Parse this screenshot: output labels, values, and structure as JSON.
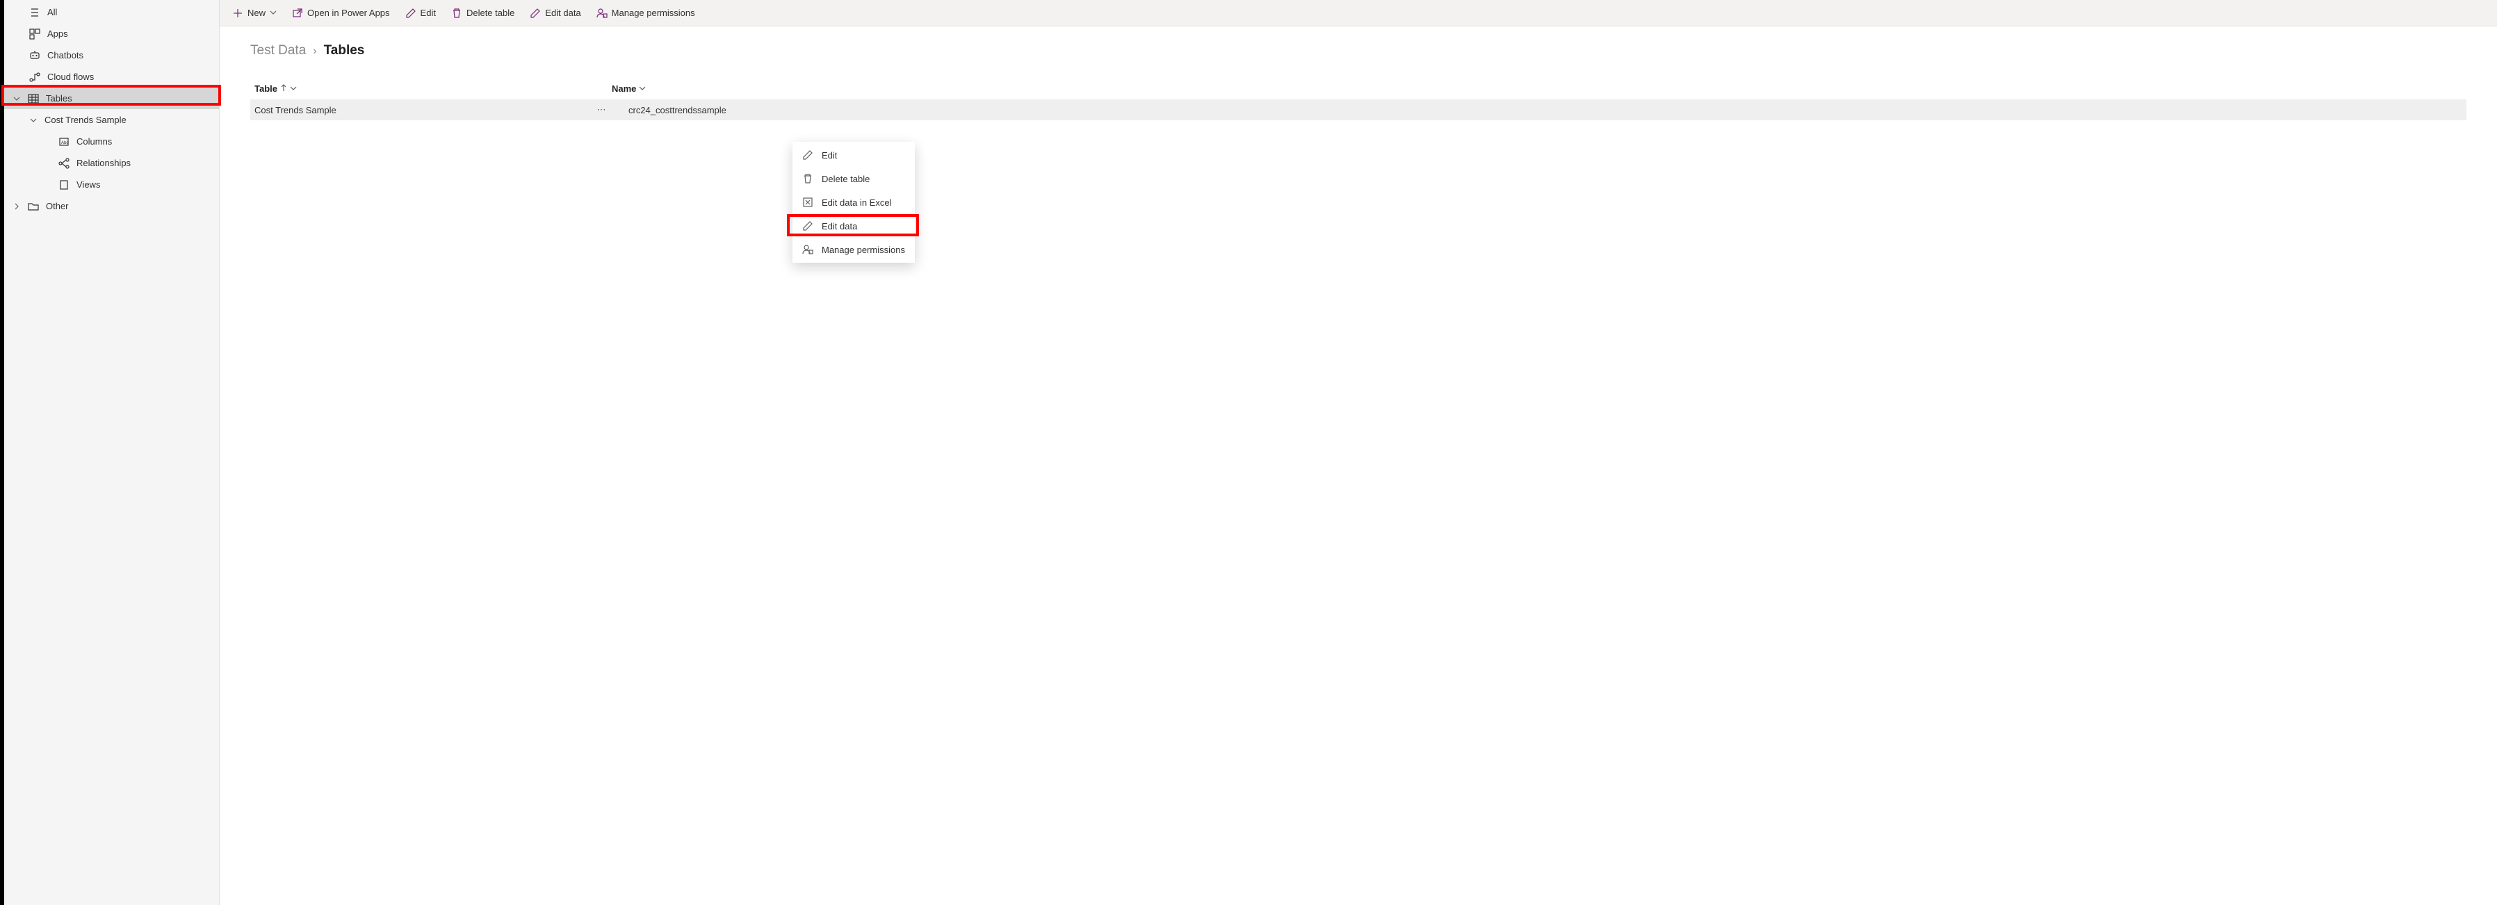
{
  "sidebar": {
    "items": [
      {
        "label": "All"
      },
      {
        "label": "Apps"
      },
      {
        "label": "Chatbots"
      },
      {
        "label": "Cloud flows"
      },
      {
        "label": "Tables"
      },
      {
        "label": "Cost Trends Sample"
      },
      {
        "label": "Columns"
      },
      {
        "label": "Relationships"
      },
      {
        "label": "Views"
      },
      {
        "label": "Other"
      }
    ]
  },
  "toolbar": {
    "new": "New",
    "open_in_power_apps": "Open in Power Apps",
    "edit": "Edit",
    "delete_table": "Delete table",
    "edit_data": "Edit data",
    "manage_permissions": "Manage permissions"
  },
  "breadcrumb": {
    "parent": "Test Data",
    "current": "Tables"
  },
  "columns": {
    "table": "Table",
    "name": "Name"
  },
  "rows": [
    {
      "table": "Cost Trends Sample",
      "name": "crc24_costtrendssample"
    }
  ],
  "context_menu": {
    "edit": "Edit",
    "delete_table": "Delete table",
    "edit_in_excel": "Edit data in Excel",
    "edit_data": "Edit data",
    "manage_permissions": "Manage permissions"
  }
}
